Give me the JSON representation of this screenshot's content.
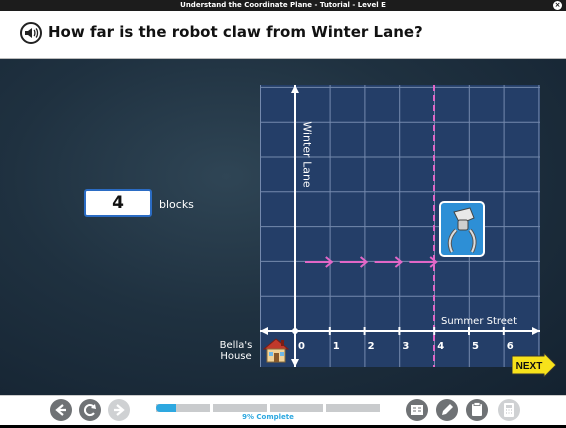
{
  "window": {
    "title": "Understand the Coordinate Plane - Tutorial - Level E",
    "close_icon": "×"
  },
  "question": {
    "text": "How far is the robot claw from Winter Lane?",
    "speaker_icon": "speaker-icon"
  },
  "answer": {
    "value": "4",
    "unit": "blocks"
  },
  "graph": {
    "y_axis_label": "Winter Lane",
    "x_axis_label": "Summer Street",
    "x_ticks": [
      "0",
      "1",
      "2",
      "3",
      "4",
      "5",
      "6"
    ],
    "origin_label_line1": "Bella's",
    "origin_label_line2": "House",
    "claw_x": 4,
    "arrow_count": 4,
    "colors": {
      "grid_bg": "#243e68",
      "dashed_line": "#e267c7",
      "arrows": "#e267c7",
      "claw_tile": "#2d8fd6"
    }
  },
  "buttons": {
    "next_label": "NEXT"
  },
  "footer": {
    "progress_percent": 9,
    "progress_text": "9% Complete",
    "nav": [
      "back-icon",
      "replay-icon",
      "forward-icon"
    ],
    "tools": [
      "glossary-icon",
      "pencil-icon",
      "notes-icon",
      "calculator-icon"
    ]
  }
}
